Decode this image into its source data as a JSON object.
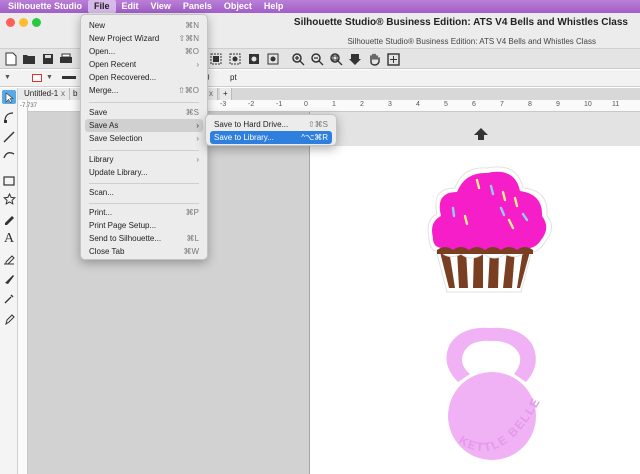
{
  "menubar": {
    "app_name": "Silhouette Studio",
    "items": [
      "File",
      "Edit",
      "View",
      "Panels",
      "Object",
      "Help"
    ]
  },
  "window": {
    "title": "Silhouette Studio® Business Edition: ATS V4 Bells and Whistles Class",
    "subtitle": "Silhouette Studio® Business Edition: ATS V4 Bells and Whistles Class"
  },
  "properties_bar": {
    "value": "0",
    "unit": "pt"
  },
  "tabs": [
    {
      "label": "Untitled-1",
      "close": "x"
    },
    {
      "label": "b",
      "close": ""
    },
    {
      "label": "x",
      "close": ""
    },
    {
      "label": "+",
      "close": ""
    }
  ],
  "ruler": {
    "values": [
      "-3",
      "-2",
      "-1",
      "0",
      "1",
      "2",
      "3",
      "4",
      "5",
      "6",
      "7",
      "8",
      "9",
      "10",
      "11"
    ],
    "vertical_readout": "-7.737"
  },
  "file_menu": {
    "groups": [
      [
        {
          "label": "New",
          "shortcut": "⌘N",
          "arrow": ""
        },
        {
          "label": "New Project Wizard",
          "shortcut": "⇧⌘N",
          "arrow": ""
        },
        {
          "label": "Open...",
          "shortcut": "⌘O",
          "arrow": ""
        },
        {
          "label": "Open Recent",
          "shortcut": "",
          "arrow": "›"
        },
        {
          "label": "Open Recovered...",
          "shortcut": "",
          "arrow": ""
        },
        {
          "label": "Merge...",
          "shortcut": "⇧⌘O",
          "arrow": ""
        }
      ],
      [
        {
          "label": "Save",
          "shortcut": "⌘S",
          "arrow": ""
        },
        {
          "label": "Save As",
          "shortcut": "",
          "arrow": "›"
        },
        {
          "label": "Save Selection",
          "shortcut": "",
          "arrow": "›"
        }
      ],
      [
        {
          "label": "Library",
          "shortcut": "",
          "arrow": "›"
        },
        {
          "label": "Update Library...",
          "shortcut": "",
          "arrow": ""
        }
      ],
      [
        {
          "label": "Scan...",
          "shortcut": "",
          "arrow": ""
        }
      ],
      [
        {
          "label": "Print...",
          "shortcut": "⌘P",
          "arrow": ""
        },
        {
          "label": "Print Page Setup...",
          "shortcut": "",
          "arrow": ""
        },
        {
          "label": "Send to Silhouette...",
          "shortcut": "⌘L",
          "arrow": ""
        },
        {
          "label": "Close Tab",
          "shortcut": "⌘W",
          "arrow": ""
        }
      ]
    ],
    "highlighted": "Save As"
  },
  "save_as_submenu": {
    "items": [
      {
        "label": "Save to Hard Drive...",
        "shortcut": "⇧⌘S"
      },
      {
        "label": "Save to Library...",
        "shortcut": "^⌥⌘R"
      }
    ],
    "selected": "Save to Library..."
  },
  "artwork": {
    "kettlebell_text": "KETTLE BELLE"
  },
  "colors": {
    "menubar": "#a25ec8",
    "accent_blue": "#2f7fde",
    "cupcake_frosting": "#f61ec9",
    "cupcake_wrapper": "#7a3f22",
    "kettlebell": "#f0b2f4",
    "kettlebell_text": "#e49ae9"
  }
}
